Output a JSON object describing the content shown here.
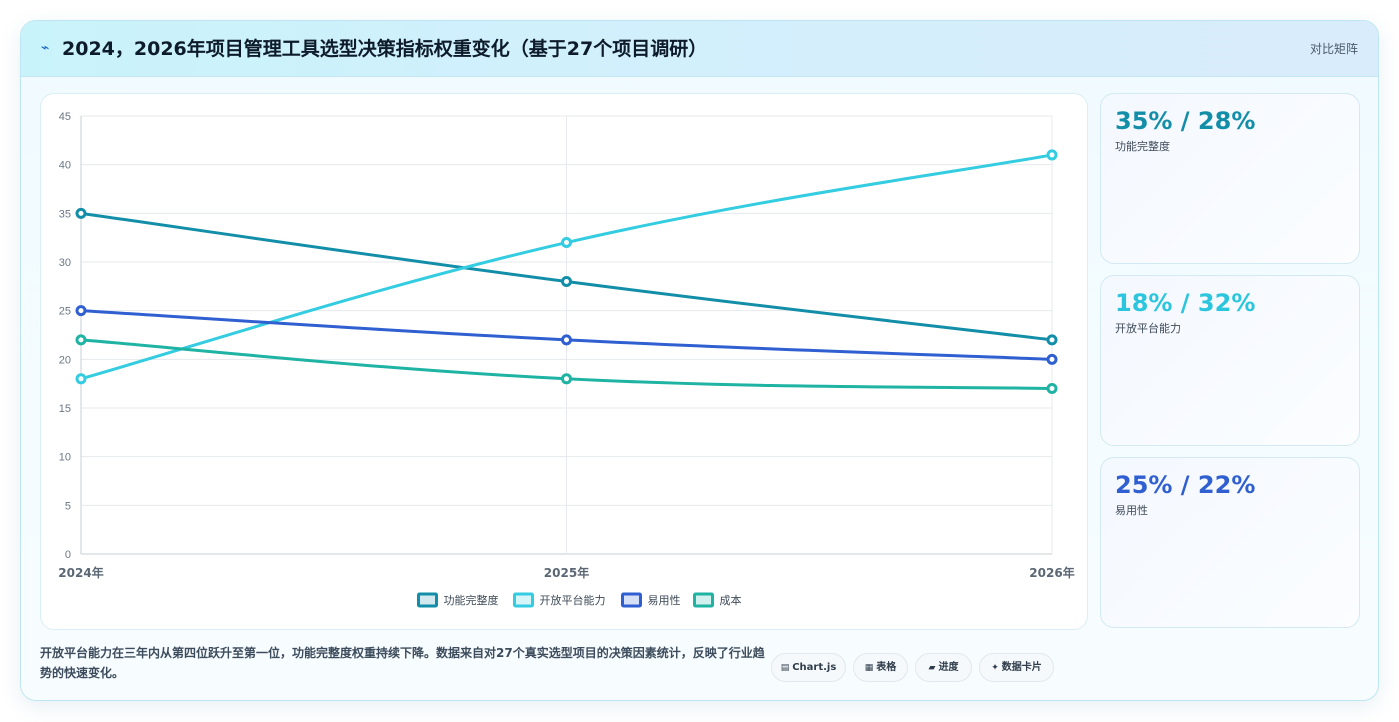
{
  "header": {
    "icon": "lightning-icon",
    "title": "2024，2026年项目管理工具选型决策指标权重变化（基于27个项目调研）",
    "right_label": "对比矩阵"
  },
  "chart_data": {
    "type": "line",
    "categories": [
      "2024年",
      "2025年",
      "2026年"
    ],
    "ylim": [
      0,
      45
    ],
    "yticks": [
      0,
      5,
      10,
      15,
      20,
      25,
      30,
      35,
      40,
      45
    ],
    "grid": true,
    "legend_position": "bottom",
    "series": [
      {
        "name": "功能完整度",
        "values": [
          35,
          28,
          22
        ],
        "color": "#138ea8"
      },
      {
        "name": "开放平台能力",
        "values": [
          18,
          32,
          41
        ],
        "color": "#33cce0"
      },
      {
        "name": "易用性",
        "values": [
          25,
          22,
          20
        ],
        "color": "#2f5fd0"
      },
      {
        "name": "成本",
        "values": [
          22,
          18,
          17
        ],
        "color": "#1fb3a3"
      }
    ]
  },
  "stats": [
    {
      "value": "35% / 28%",
      "label": "功能完整度",
      "color": "#138ea8"
    },
    {
      "value": "18% / 32%",
      "label": "开放平台能力",
      "color": "#2bc6de"
    },
    {
      "value": "25% / 22%",
      "label": "易用性",
      "color": "#2f5fd0"
    }
  ],
  "caption": "开放平台能力在三年内从第四位跃升至第一位，功能完整度权重持续下降。数据来自对27个真实选型项目的决策因素统计，反映了行业趋势的快速变化。",
  "tags": [
    {
      "icon": "chart-icon",
      "glyph": "▤",
      "label": "Chart.js"
    },
    {
      "icon": "table-icon",
      "glyph": "▦",
      "label": "表格"
    },
    {
      "icon": "progress-icon",
      "glyph": "▰",
      "label": "进度"
    },
    {
      "icon": "card-icon",
      "glyph": "✦",
      "label": "数据卡片"
    }
  ]
}
